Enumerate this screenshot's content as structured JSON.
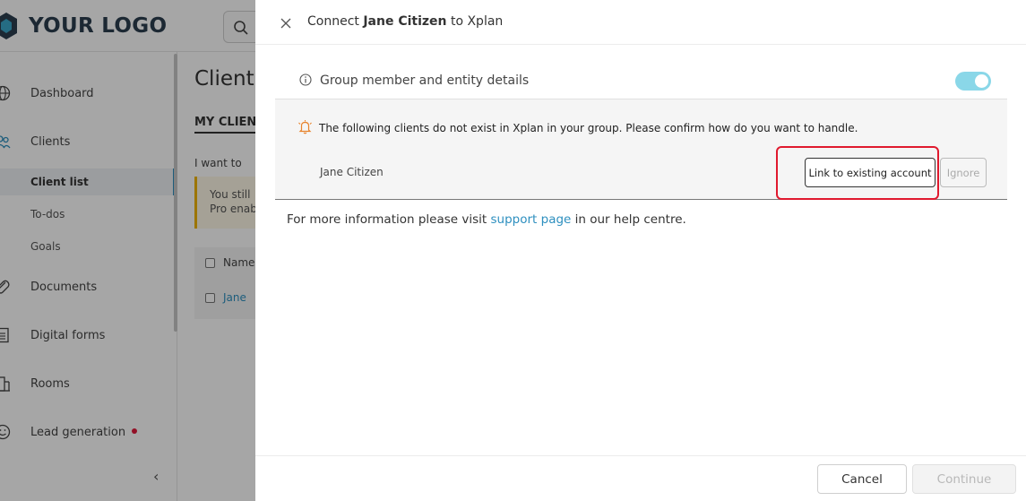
{
  "app": {
    "logo_text": "YOUR LOGO",
    "page_title": "Client",
    "tab_label": "MY CLIENT",
    "i_want_to": "I want to",
    "notice_line1": "You still",
    "notice_line2": "Pro enab",
    "table_header": "Name",
    "table_row_name": "Jane"
  },
  "sidebar": {
    "items": [
      {
        "label": "Dashboard",
        "icon": "globe-icon"
      },
      {
        "label": "Clients",
        "icon": "users-icon"
      },
      {
        "label": "Client list"
      },
      {
        "label": "To-dos"
      },
      {
        "label": "Goals"
      },
      {
        "label": "Documents",
        "icon": "paperclip-icon"
      },
      {
        "label": "Digital forms",
        "icon": "form-icon"
      },
      {
        "label": "Rooms",
        "icon": "building-icon"
      },
      {
        "label": "Lead generation",
        "icon": "smile-icon"
      }
    ],
    "collapse_glyph": "‹"
  },
  "drawer": {
    "title_prefix": "Connect ",
    "title_name": "Jane Citizen",
    "title_suffix": " to Xplan",
    "group_label": "Group member and entity details",
    "toggle_on": true,
    "warning_text": "The following clients do not exist in Xplan in your group. Please confirm how do you want to handle.",
    "client_name": "Jane Citizen",
    "link_button": "Link to existing account",
    "ignore_button": "Ignore",
    "info_prefix": "For more information please visit ",
    "info_link": "support page",
    "info_suffix": " in our help centre.",
    "cancel_button": "Cancel",
    "continue_button": "Continue"
  },
  "colors": {
    "accent_link": "#2d8fbf",
    "toggle": "#8ad7e8",
    "highlight": "#e0192e",
    "warning_icon": "#e8822a"
  }
}
